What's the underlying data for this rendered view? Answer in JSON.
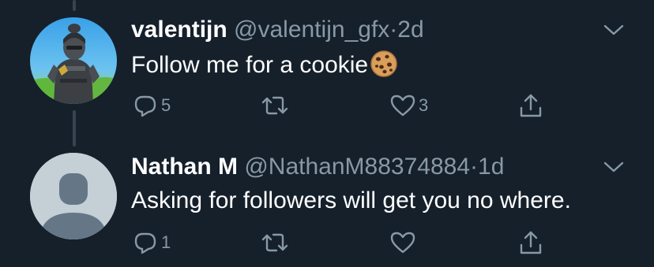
{
  "tweets": [
    {
      "display_name": "valentijn",
      "handle": "@valentijn_gfx",
      "separator": "·",
      "time": "2d",
      "text": "Follow me for a cookie",
      "emoji": "🍪",
      "avatar": "fortnite-character-avatar",
      "replies": "5",
      "retweets": "",
      "likes": "3"
    },
    {
      "display_name": "Nathan M",
      "handle": "@NathanM88374884",
      "separator": "·",
      "time": "1d",
      "text": "Asking for followers will get you no where.",
      "avatar": "default-avatar",
      "replies": "1",
      "retweets": "",
      "likes": ""
    }
  ],
  "icons": {
    "reply": "reply-icon",
    "retweet": "retweet-icon",
    "like": "heart-icon",
    "share": "share-icon",
    "menu": "chevron-down-icon"
  },
  "colors": {
    "background": "#15202b",
    "primary_text": "#ffffff",
    "secondary_text": "#8899a6",
    "thread_line": "#38444d"
  }
}
